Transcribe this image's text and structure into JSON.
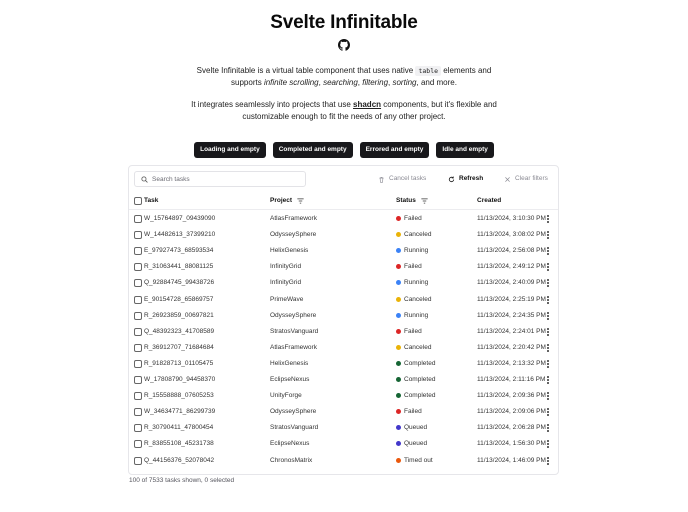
{
  "header": {
    "title": "Svelte Infinitable",
    "github_icon": "github-icon",
    "intro": {
      "a": "Svelte Infinitable is a virtual table component that uses native",
      "code": "table",
      "b": "elements and",
      "c": "supports",
      "s1": "infinite scrolling",
      "s2": "searching",
      "s3": "filtering",
      "s4": "sorting",
      "d": ", and more."
    },
    "integration": {
      "a": "It integrates seamlessly into projects that use",
      "link": "shadcn",
      "b": "components, but it's flexible and",
      "c": "customizable enough to fit the needs of any other project."
    }
  },
  "presets": [
    "Loading and empty",
    "Completed and empty",
    "Errored and empty",
    "Idle and empty"
  ],
  "toolbar": {
    "search_placeholder": "Search tasks",
    "cancel_label": "Cancel tasks",
    "refresh_label": "Refresh",
    "clear_label": "Clear filters"
  },
  "columns": {
    "task": "Task",
    "project": "Project",
    "status": "Status",
    "created": "Created"
  },
  "status_colors": {
    "Failed": "#dc2626",
    "Canceled": "#eab308",
    "Running": "#3b82f6",
    "Completed": "#166534",
    "Queued": "#4338ca",
    "Timed out": "#ea580c"
  },
  "rows": [
    {
      "task": "W_15764897_09439090",
      "project": "AtlasFramework",
      "status": "Failed",
      "created": "11/13/2024, 3:10:30 PM"
    },
    {
      "task": "W_14482613_37399210",
      "project": "OdysseySphere",
      "status": "Canceled",
      "created": "11/13/2024, 3:08:02 PM"
    },
    {
      "task": "E_97927473_68593534",
      "project": "HelixGenesis",
      "status": "Running",
      "created": "11/13/2024, 2:56:08 PM"
    },
    {
      "task": "R_31063441_88081125",
      "project": "InfinityGrid",
      "status": "Failed",
      "created": "11/13/2024, 2:49:12 PM"
    },
    {
      "task": "Q_92884745_99438726",
      "project": "InfinityGrid",
      "status": "Running",
      "created": "11/13/2024, 2:40:09 PM"
    },
    {
      "task": "E_90154728_65869757",
      "project": "PrimeWave",
      "status": "Canceled",
      "created": "11/13/2024, 2:25:19 PM"
    },
    {
      "task": "R_26923859_00697821",
      "project": "OdysseySphere",
      "status": "Running",
      "created": "11/13/2024, 2:24:35 PM"
    },
    {
      "task": "Q_48392323_41708589",
      "project": "StratosVanguard",
      "status": "Failed",
      "created": "11/13/2024, 2:24:01 PM"
    },
    {
      "task": "R_36912707_71684684",
      "project": "AtlasFramework",
      "status": "Canceled",
      "created": "11/13/2024, 2:20:42 PM"
    },
    {
      "task": "R_91828713_01105475",
      "project": "HelixGenesis",
      "status": "Completed",
      "created": "11/13/2024, 2:13:32 PM"
    },
    {
      "task": "W_17808790_94458370",
      "project": "EclipseNexus",
      "status": "Completed",
      "created": "11/13/2024, 2:11:16 PM"
    },
    {
      "task": "R_15558888_07605253",
      "project": "UnityForge",
      "status": "Completed",
      "created": "11/13/2024, 2:09:36 PM"
    },
    {
      "task": "W_34634771_86299739",
      "project": "OdysseySphere",
      "status": "Failed",
      "created": "11/13/2024, 2:09:06 PM"
    },
    {
      "task": "R_30790411_47800454",
      "project": "StratosVanguard",
      "status": "Queued",
      "created": "11/13/2024, 2:06:28 PM"
    },
    {
      "task": "R_83855108_45231738",
      "project": "EclipseNexus",
      "status": "Queued",
      "created": "11/13/2024, 1:56:30 PM"
    },
    {
      "task": "Q_44156376_52078042",
      "project": "ChronosMatrix",
      "status": "Timed out",
      "created": "11/13/2024, 1:46:09 PM"
    }
  ],
  "footer": {
    "summary": "100 of 7533 tasks shown, 0 selected"
  }
}
